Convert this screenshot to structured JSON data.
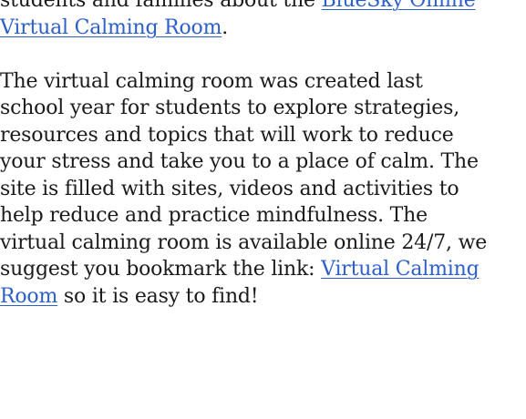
{
  "paragraphs": [
    {
      "lines": [
        [
          {
            "text": "students and families about the "
          },
          {
            "text": "BlueSky Online",
            "link": true
          }
        ],
        [
          {
            "text": "Virtual Calming Room",
            "link": true
          },
          {
            "text": "."
          }
        ]
      ]
    },
    {
      "lines": [
        [
          {
            "text": "The virtual calming room was created last"
          }
        ],
        [
          {
            "text": "school year for students to explore strategies,"
          }
        ],
        [
          {
            "text": "resources and topics that will work to reduce"
          }
        ],
        [
          {
            "text": "your stress and take you to a place of calm. The"
          }
        ],
        [
          {
            "text": "site is filled with sites, videos and activities to"
          }
        ],
        [
          {
            "text": "help reduce and practice mindfulness. The"
          }
        ],
        [
          {
            "text": "virtual calming room is available online 24/7, we"
          }
        ],
        [
          {
            "text": "suggest you bookmark the link: "
          },
          {
            "text": "Virtual Calming",
            "link": true
          }
        ],
        [
          {
            "text": "Room",
            "link": true
          },
          {
            "text": " so it is easy to find!"
          }
        ]
      ]
    }
  ],
  "colors": {
    "text": "#1a1a1a",
    "link": "#2c5fc9",
    "background": "#ffffff"
  }
}
